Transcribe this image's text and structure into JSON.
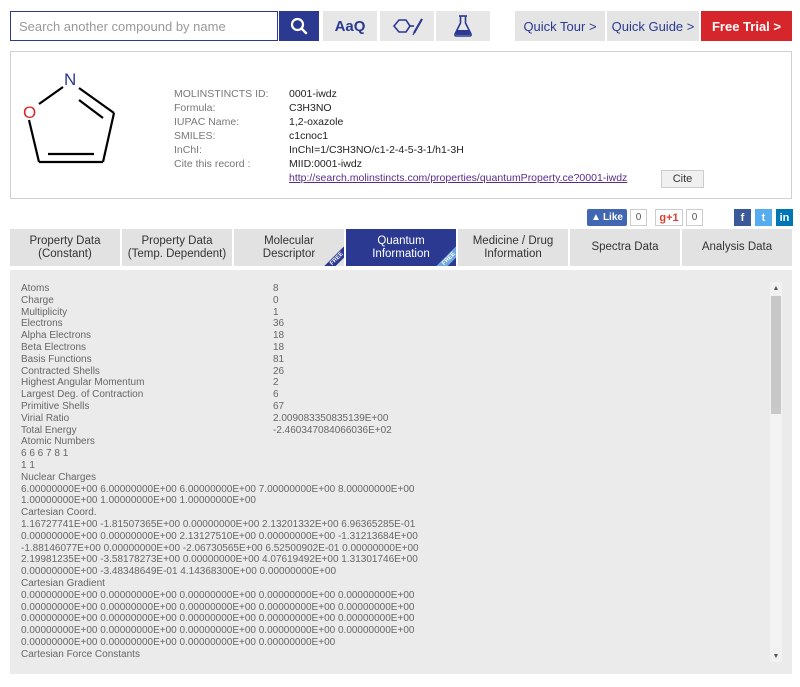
{
  "search": {
    "placeholder": "Search another compound by name"
  },
  "toolbar": {
    "aaq_label": "AaQ",
    "quick_tour": "Quick Tour  >",
    "quick_guide": "Quick Guide  >",
    "free_trial": "Free Trial  >"
  },
  "molecule": {
    "atom_n": "N",
    "atom_o": "O"
  },
  "record": {
    "labels": [
      "MOLINSTINCTS ID:",
      "Formula:",
      "IUPAC Name:",
      "SMILES:",
      "InChI:",
      "Cite this record :"
    ],
    "id": "0001-iwdz",
    "formula": "C3H3NO",
    "iupac": "1,2-oxazole",
    "smiles": "c1cnoc1",
    "inchi": "InChI=1/C3H3NO/c1-2-4-5-3-1/h1-3H",
    "cite_id": "MIID:0001-iwdz",
    "cite_url": "http://search.molinstincts.com/properties/quantumProperty.ce?0001-iwdz",
    "cite_button": "Cite"
  },
  "social": {
    "fb_like": "Like",
    "fb_count": "0",
    "gplus": "g+1",
    "gplus_count": "0",
    "share_fb": "f",
    "share_tw": "t",
    "share_in": "in"
  },
  "tabs": [
    {
      "label": "Property Data\n(Constant)",
      "free": ""
    },
    {
      "label": "Property Data\n(Temp. Dependent)",
      "free": ""
    },
    {
      "label": "Molecular\nDescriptor",
      "free": "FREE"
    },
    {
      "label": "Quantum\nInformation",
      "free": "FREE"
    },
    {
      "label": "Medicine / Drug\nInformation",
      "free": ""
    },
    {
      "label": "Spectra Data",
      "free": ""
    },
    {
      "label": "Analysis Data",
      "free": ""
    }
  ],
  "active_tab": 3,
  "quantum": {
    "properties": [
      {
        "k": "Atoms",
        "v": "8"
      },
      {
        "k": "Charge",
        "v": "0"
      },
      {
        "k": "Multiplicity",
        "v": "1"
      },
      {
        "k": "Electrons",
        "v": "36"
      },
      {
        "k": "Alpha Electrons",
        "v": "18"
      },
      {
        "k": "Beta Electrons",
        "v": "18"
      },
      {
        "k": "Basis Functions",
        "v": "81"
      },
      {
        "k": "Contracted Shells",
        "v": "26"
      },
      {
        "k": "Highest Angular Momentum",
        "v": "2"
      },
      {
        "k": "Largest Deg. of Contraction",
        "v": "6"
      },
      {
        "k": "Primitive Shells",
        "v": "67"
      },
      {
        "k": "Virial Ratio",
        "v": "2.009083350835139E+00"
      },
      {
        "k": "Total Energy",
        "v": "-2.460347084066036E+02"
      }
    ],
    "blocks": [
      "Atomic Numbers",
      "6 6 6 7 8 1",
      "1 1",
      "Nuclear Charges",
      "6.00000000E+00 6.00000000E+00 6.00000000E+00 7.00000000E+00 8.00000000E+00",
      "1.00000000E+00 1.00000000E+00 1.00000000E+00",
      "Cartesian Coord.",
      "1.16727741E+00 -1.81507365E+00 0.00000000E+00 2.13201332E+00 6.96365285E-01",
      "0.00000000E+00 0.00000000E+00 2.13127510E+00 0.00000000E+00 -1.31213684E+00",
      "-1.88146077E+00 0.00000000E+00 -2.06730565E+00 6.52500902E-01 0.00000000E+00",
      "2.19981235E+00 -3.58178273E+00 0.00000000E+00 4.07619492E+00 1.31301746E+00",
      "0.00000000E+00 -3.48348649E-01 4.14368300E+00 0.00000000E+00",
      "Cartesian Gradient",
      "0.00000000E+00 0.00000000E+00 0.00000000E+00 0.00000000E+00 0.00000000E+00",
      "0.00000000E+00 0.00000000E+00 0.00000000E+00 0.00000000E+00 0.00000000E+00",
      "0.00000000E+00 0.00000000E+00 0.00000000E+00 0.00000000E+00 0.00000000E+00",
      "0.00000000E+00 0.00000000E+00 0.00000000E+00 0.00000000E+00 0.00000000E+00",
      "0.00000000E+00 0.00000000E+00 0.00000000E+00 0.00000000E+00",
      "Cartesian Force Constants"
    ]
  },
  "colors": {
    "brand": "#2b3990",
    "trial": "#d7262b",
    "link": "#5b2a8c"
  }
}
